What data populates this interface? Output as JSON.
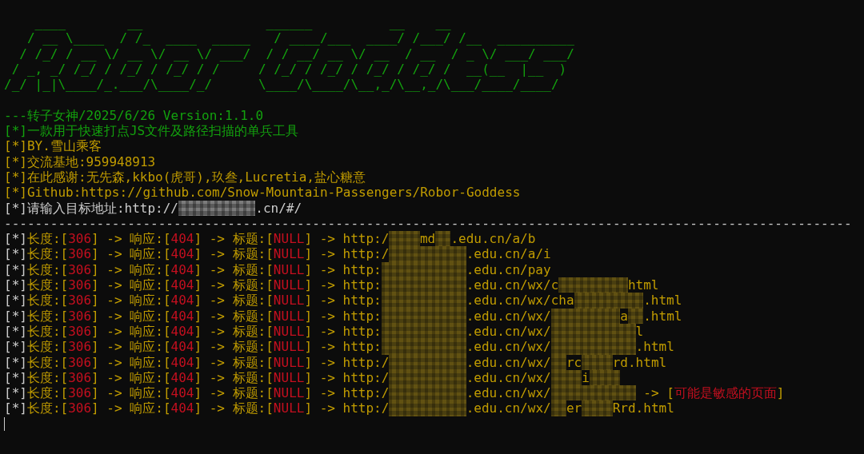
{
  "banner": [
    "    ____        __                ______          __    __",
    "   / __ \\____  / /_  ____  _____   / ____/___  ____/ /___/ /__  __________",
    "  / /_/ / __ \\/ __ \\/ __ \\/ ___/  / / __/ __ \\/ __  / __  / _ \\/ ___/ ___/",
    " / _, _/ /_/ / /_/ / /_/ / /     / /_/ / /_/ / /_/ / /_/ /  __(__  |__  )",
    "/_/ |_|\\____/_.___/\\____/_/      \\____/\\____/\\__,_/\\__,_/\\___/____/____/"
  ],
  "header": [
    {
      "pieces": [
        {
          "text": "---转子女神/2025/6/26 Version:1.1.0",
          "kind": "note"
        }
      ]
    },
    {
      "pieces": [
        {
          "text": "[*]一款用于快速打点JS文件及路径扫描的单兵工具",
          "kind": "note"
        }
      ]
    },
    {
      "pieces": [
        {
          "text": "[*]BY.雪山乘客",
          "kind": "field"
        }
      ]
    },
    {
      "pieces": [
        {
          "text": "[*]交流基地:959948913",
          "kind": "field"
        }
      ]
    },
    {
      "pieces": [
        {
          "text": "[*]在此感谢:无先森,kkbo(虎哥),玖叁,Lucretia,盐心糖意",
          "kind": "field"
        }
      ]
    },
    {
      "pieces": [
        {
          "text": "[*]Github:https://github.com/Snow-Mountain-Passengers/Robor-Goddess",
          "kind": "field"
        }
      ]
    },
    {
      "pieces": [
        {
          "text": "[*]请输入目标地址:http://",
          "kind": "prefix"
        },
        {
          "kind": "inputmask"
        },
        {
          "text": ".cn/#/",
          "kind": "prefix"
        }
      ]
    }
  ],
  "separator": "--------------------------------------------------------------------------------------------------------------",
  "results": [
    {
      "pieces": [
        {
          "text": "[*]",
          "kind": "prefix"
        },
        {
          "text": "长度:[",
          "kind": "field"
        },
        {
          "text": "306",
          "kind": "value"
        },
        {
          "text": "] -> 响应:[",
          "kind": "field"
        },
        {
          "text": "404",
          "kind": "value"
        },
        {
          "text": "] -> 标题:[",
          "kind": "field"
        },
        {
          "text": "NULL",
          "kind": "value"
        },
        {
          "text": "] -> http:/",
          "kind": "field"
        },
        {
          "kind": "shortmask"
        },
        {
          "text": "md",
          "kind": "field"
        },
        {
          "kind": "bitmask"
        },
        {
          "text": ".edu.cn/a/b",
          "kind": "field"
        }
      ]
    },
    {
      "pieces": [
        {
          "text": "[*]",
          "kind": "prefix"
        },
        {
          "text": "长度:[",
          "kind": "field"
        },
        {
          "text": "306",
          "kind": "value"
        },
        {
          "text": "] -> 响应:[",
          "kind": "field"
        },
        {
          "text": "404",
          "kind": "value"
        },
        {
          "text": "] -> 标题:[",
          "kind": "field"
        },
        {
          "text": "NULL",
          "kind": "value"
        },
        {
          "text": "] -> http:/",
          "kind": "field"
        },
        {
          "kind": "hostmask"
        },
        {
          "text": ".edu.cn/a/i",
          "kind": "field"
        }
      ]
    },
    {
      "pieces": [
        {
          "text": "[*]",
          "kind": "prefix"
        },
        {
          "text": "长度:[",
          "kind": "field"
        },
        {
          "text": "306",
          "kind": "value"
        },
        {
          "text": "] -> 响应:[",
          "kind": "field"
        },
        {
          "text": "404",
          "kind": "value"
        },
        {
          "text": "] -> 标题:[",
          "kind": "field"
        },
        {
          "text": "NULL",
          "kind": "value"
        },
        {
          "text": "] -> http:",
          "kind": "field"
        },
        {
          "kind": "longhostmask"
        },
        {
          "text": ".edu.cn/pay",
          "kind": "field"
        }
      ]
    },
    {
      "pieces": [
        {
          "text": "[*]",
          "kind": "prefix"
        },
        {
          "text": "长度:[",
          "kind": "field"
        },
        {
          "text": "306",
          "kind": "value"
        },
        {
          "text": "] -> 响应:[",
          "kind": "field"
        },
        {
          "text": "404",
          "kind": "value"
        },
        {
          "text": "] -> 标题:[",
          "kind": "field"
        },
        {
          "text": "NULL",
          "kind": "value"
        },
        {
          "text": "] -> http:",
          "kind": "field"
        },
        {
          "kind": "longhostmask"
        },
        {
          "text": ".edu.cn/wx/c",
          "kind": "field"
        },
        {
          "kind": "pathmask"
        },
        {
          "text": "html",
          "kind": "field"
        }
      ]
    },
    {
      "pieces": [
        {
          "text": "[*]",
          "kind": "prefix"
        },
        {
          "text": "长度:[",
          "kind": "field"
        },
        {
          "text": "306",
          "kind": "value"
        },
        {
          "text": "] -> 响应:[",
          "kind": "field"
        },
        {
          "text": "404",
          "kind": "value"
        },
        {
          "text": "] -> 标题:[",
          "kind": "field"
        },
        {
          "text": "NULL",
          "kind": "value"
        },
        {
          "text": "] -> http:",
          "kind": "field"
        },
        {
          "kind": "longhostmask"
        },
        {
          "text": ".edu.cn/wx/cha",
          "kind": "field"
        },
        {
          "kind": "pathmask"
        },
        {
          "text": ".html",
          "kind": "field"
        }
      ]
    },
    {
      "pieces": [
        {
          "text": "[*]",
          "kind": "prefix"
        },
        {
          "text": "长度:[",
          "kind": "field"
        },
        {
          "text": "306",
          "kind": "value"
        },
        {
          "text": "] -> 响应:[",
          "kind": "field"
        },
        {
          "text": "404",
          "kind": "value"
        },
        {
          "text": "] -> 标题:[",
          "kind": "field"
        },
        {
          "text": "NULL",
          "kind": "value"
        },
        {
          "text": "] -> http:",
          "kind": "field"
        },
        {
          "kind": "longhostmask"
        },
        {
          "text": ".edu.cn/wx/",
          "kind": "field"
        },
        {
          "kind": "pathmask"
        },
        {
          "text": "a",
          "kind": "field"
        },
        {
          "kind": "bitmask"
        },
        {
          "text": ".html",
          "kind": "field"
        }
      ]
    },
    {
      "pieces": [
        {
          "text": "[*]",
          "kind": "prefix"
        },
        {
          "text": "长度:[",
          "kind": "field"
        },
        {
          "text": "306",
          "kind": "value"
        },
        {
          "text": "] -> 响应:[",
          "kind": "field"
        },
        {
          "text": "404",
          "kind": "value"
        },
        {
          "text": "] -> 标题:[",
          "kind": "field"
        },
        {
          "text": "NULL",
          "kind": "value"
        },
        {
          "text": "] -> http:",
          "kind": "field"
        },
        {
          "kind": "longhostmask"
        },
        {
          "text": ".edu.cn/wx/",
          "kind": "field"
        },
        {
          "kind": "longpathmask"
        },
        {
          "text": "l",
          "kind": "field"
        }
      ]
    },
    {
      "pieces": [
        {
          "text": "[*]",
          "kind": "prefix"
        },
        {
          "text": "长度:[",
          "kind": "field"
        },
        {
          "text": "306",
          "kind": "value"
        },
        {
          "text": "] -> 响应:[",
          "kind": "field"
        },
        {
          "text": "404",
          "kind": "value"
        },
        {
          "text": "] -> 标题:[",
          "kind": "field"
        },
        {
          "text": "NULL",
          "kind": "value"
        },
        {
          "text": "] -> http:",
          "kind": "field"
        },
        {
          "kind": "longhostmask"
        },
        {
          "text": ".edu.cn/wx/",
          "kind": "field"
        },
        {
          "kind": "longpathmask"
        },
        {
          "text": ".html",
          "kind": "field"
        }
      ]
    },
    {
      "pieces": [
        {
          "text": "[*]",
          "kind": "prefix"
        },
        {
          "text": "长度:[",
          "kind": "field"
        },
        {
          "text": "306",
          "kind": "value"
        },
        {
          "text": "] -> 响应:[",
          "kind": "field"
        },
        {
          "text": "404",
          "kind": "value"
        },
        {
          "text": "] -> 标题:[",
          "kind": "field"
        },
        {
          "text": "NULL",
          "kind": "value"
        },
        {
          "text": "] -> http:/",
          "kind": "field"
        },
        {
          "kind": "hostmask"
        },
        {
          "text": ".edu.cn/wx/",
          "kind": "field"
        },
        {
          "kind": "bitmask"
        },
        {
          "text": "rc",
          "kind": "field"
        },
        {
          "kind": "shortmask"
        },
        {
          "text": "rd.html",
          "kind": "field"
        }
      ]
    },
    {
      "pieces": [
        {
          "text": "[*]",
          "kind": "prefix"
        },
        {
          "text": "长度:[",
          "kind": "field"
        },
        {
          "text": "306",
          "kind": "value"
        },
        {
          "text": "] -> 响应:[",
          "kind": "field"
        },
        {
          "text": "404",
          "kind": "value"
        },
        {
          "text": "] -> 标题:[",
          "kind": "field"
        },
        {
          "text": "NULL",
          "kind": "value"
        },
        {
          "text": "] -> http:/",
          "kind": "field"
        },
        {
          "kind": "hostmask"
        },
        {
          "text": ".edu.cn/wx/",
          "kind": "field"
        },
        {
          "kind": "shortmask"
        },
        {
          "text": "i",
          "kind": "field"
        },
        {
          "kind": "shortmask"
        }
      ]
    },
    {
      "pieces": [
        {
          "text": "[*]",
          "kind": "prefix"
        },
        {
          "text": "长度:[",
          "kind": "field"
        },
        {
          "text": "306",
          "kind": "value"
        },
        {
          "text": "] -> 响应:[",
          "kind": "field"
        },
        {
          "text": "404",
          "kind": "value"
        },
        {
          "text": "] -> 标题:[",
          "kind": "field"
        },
        {
          "text": "NULL",
          "kind": "value"
        },
        {
          "text": "] -> http:/",
          "kind": "field"
        },
        {
          "kind": "hostmask"
        },
        {
          "text": ".edu.cn/wx/",
          "kind": "field"
        },
        {
          "kind": "longpathmask"
        },
        {
          "text": " -> [",
          "kind": "field"
        },
        {
          "text": "可能是敏感的页面",
          "kind": "value"
        },
        {
          "text": "]",
          "kind": "field"
        }
      ]
    },
    {
      "pieces": [
        {
          "text": "[*]",
          "kind": "prefix"
        },
        {
          "text": "长度:[",
          "kind": "field"
        },
        {
          "text": "306",
          "kind": "value"
        },
        {
          "text": "] -> 响应:[",
          "kind": "field"
        },
        {
          "text": "404",
          "kind": "value"
        },
        {
          "text": "] -> 标题:[",
          "kind": "field"
        },
        {
          "text": "NULL",
          "kind": "value"
        },
        {
          "text": "] -> http:/",
          "kind": "field"
        },
        {
          "kind": "hostmask"
        },
        {
          "text": ".edu.cn/wx/",
          "kind": "field"
        },
        {
          "kind": "bitmask"
        },
        {
          "text": "er",
          "kind": "field"
        },
        {
          "kind": "shortmask"
        },
        {
          "text": "Rrd.html",
          "kind": "field"
        }
      ]
    }
  ]
}
